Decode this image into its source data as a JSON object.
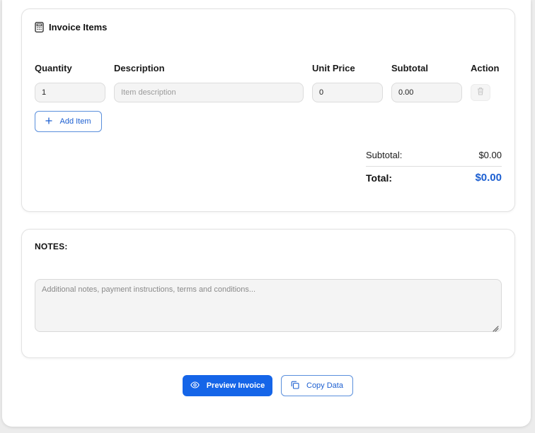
{
  "items_card": {
    "title": "Invoice Items",
    "title_icon": "calculator-icon",
    "columns": {
      "quantity": "Quantity",
      "description": "Description",
      "unit_price": "Unit Price",
      "subtotal": "Subtotal",
      "action": "Action"
    },
    "row": {
      "quantity": "1",
      "description_placeholder": "Item description",
      "unit_price": "0",
      "subtotal": "0.00",
      "delete_icon": "trash-icon"
    },
    "add_item_label": "Add Item",
    "add_item_icon": "plus-icon",
    "summary": {
      "subtotal_label": "Subtotal:",
      "subtotal_value": "$0.00",
      "total_label": "Total:",
      "total_value": "$0.00"
    }
  },
  "notes_card": {
    "title": "NOTES:",
    "placeholder": "Additional notes, payment instructions, terms and conditions..."
  },
  "actions": {
    "preview_label": "Preview Invoice",
    "preview_icon": "eye-icon",
    "copy_label": "Copy Data",
    "copy_icon": "copy-icon"
  },
  "colors": {
    "accent": "#1565e8",
    "total": "#1c5fd1",
    "field_bg": "#f4f4f4"
  }
}
